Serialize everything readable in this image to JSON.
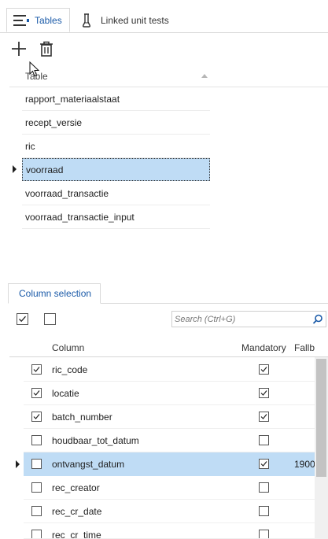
{
  "tabs": {
    "tables": "Tables",
    "linked_unit_tests": "Linked unit tests"
  },
  "tables_grid": {
    "header": "Table",
    "rows": [
      {
        "name": "rapport_materiaalstaat",
        "selected": false
      },
      {
        "name": "recept_versie",
        "selected": false
      },
      {
        "name": "ric",
        "selected": false
      },
      {
        "name": "voorraad",
        "selected": true
      },
      {
        "name": "voorraad_transactie",
        "selected": false
      },
      {
        "name": "voorraad_transactie_input",
        "selected": false
      }
    ]
  },
  "column_selection": {
    "tab_label": "Column selection",
    "search_placeholder": "Search (Ctrl+G)",
    "headers": {
      "column": "Column",
      "mandatory": "Mandatory",
      "fallback": "Fallb"
    },
    "rows": [
      {
        "name": "ric_code",
        "selected_cb": true,
        "mandatory": true,
        "fallback": "",
        "selected": false
      },
      {
        "name": "locatie",
        "selected_cb": true,
        "mandatory": true,
        "fallback": "",
        "selected": false
      },
      {
        "name": "batch_number",
        "selected_cb": true,
        "mandatory": true,
        "fallback": "",
        "selected": false
      },
      {
        "name": "houdbaar_tot_datum",
        "selected_cb": false,
        "mandatory": false,
        "fallback": "",
        "selected": false
      },
      {
        "name": "ontvangst_datum",
        "selected_cb": false,
        "mandatory": true,
        "fallback": "1900",
        "selected": true
      },
      {
        "name": "rec_creator",
        "selected_cb": false,
        "mandatory": false,
        "fallback": "",
        "selected": false
      },
      {
        "name": "rec_cr_date",
        "selected_cb": false,
        "mandatory": false,
        "fallback": "",
        "selected": false
      },
      {
        "name": "rec_cr_time",
        "selected_cb": false,
        "mandatory": false,
        "fallback": "",
        "selected": false
      }
    ]
  },
  "colors": {
    "accent_text": "#1a5aa8",
    "selection_bg": "#bfdcf5"
  },
  "icons": [
    "hamburger-icon",
    "beaker-icon",
    "plus-icon",
    "trash-icon",
    "sort-up-icon",
    "search-icon",
    "checkmark-icon"
  ]
}
